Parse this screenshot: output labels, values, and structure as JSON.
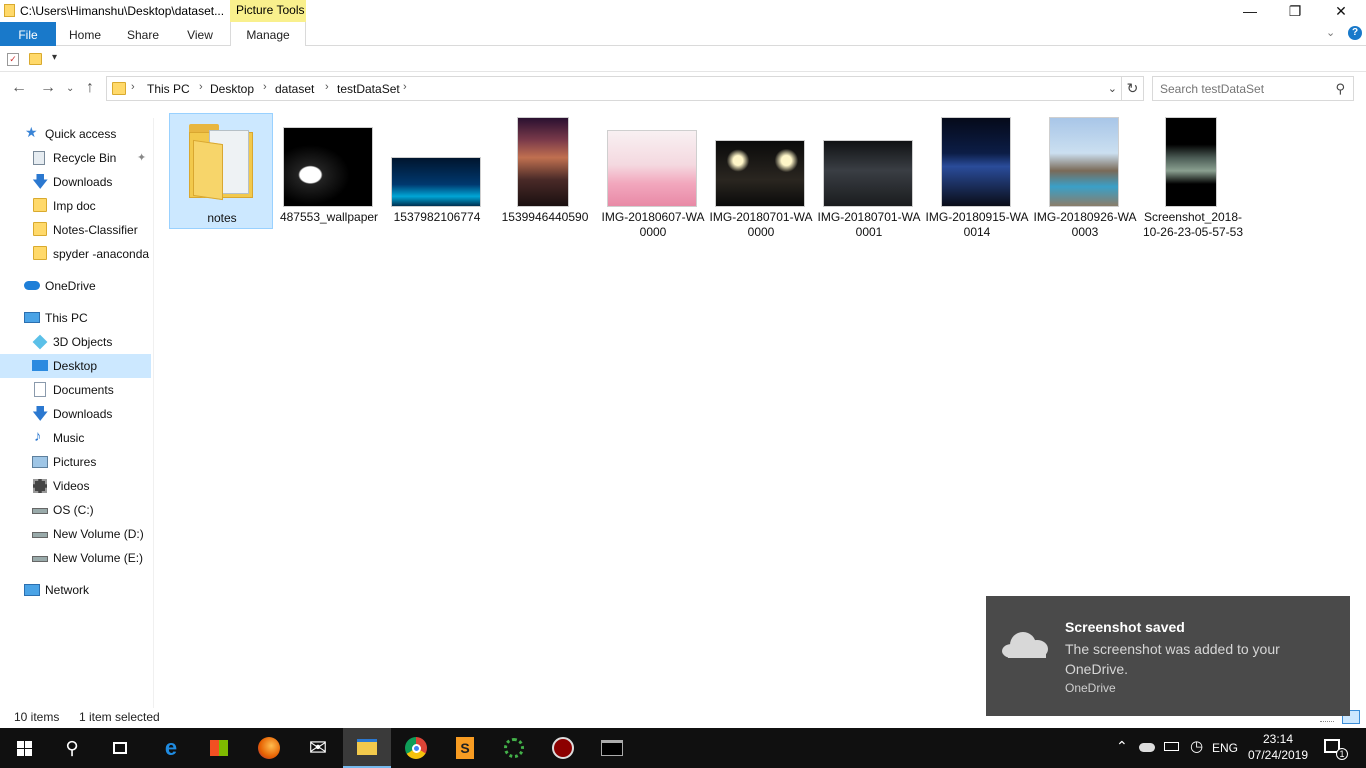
{
  "window": {
    "title": "C:\\Users\\Himanshu\\Desktop\\dataset...",
    "context_tab_group": "Picture Tools"
  },
  "ribbon": {
    "tabs": [
      "File",
      "Home",
      "Share",
      "View",
      "Manage"
    ]
  },
  "address": {
    "crumbs": [
      "This PC",
      "Desktop",
      "dataset",
      "testDataSet"
    ]
  },
  "search": {
    "placeholder": "Search testDataSet"
  },
  "sidebar": {
    "quick_access": "Quick access",
    "quick_items": [
      "Recycle Bin",
      "Downloads",
      "Imp doc",
      "Notes-Classifier",
      "spyder -anaconda"
    ],
    "onedrive": "OneDrive",
    "this_pc": "This PC",
    "pc_items": [
      "3D Objects",
      "Desktop",
      "Documents",
      "Downloads",
      "Music",
      "Pictures",
      "Videos",
      "OS (C:)",
      "New Volume (D:)",
      "New Volume (E:)"
    ],
    "network": "Network"
  },
  "files": [
    {
      "name": "notes"
    },
    {
      "name": "487553_wallpaper"
    },
    {
      "name": "1537982106774"
    },
    {
      "name": "1539946440590"
    },
    {
      "name": "IMG-20180607-WA0000"
    },
    {
      "name": "IMG-20180701-WA0000"
    },
    {
      "name": "IMG-20180701-WA0001"
    },
    {
      "name": "IMG-20180915-WA0014"
    },
    {
      "name": "IMG-20180926-WA0003"
    },
    {
      "name": "Screenshot_2018-10-26-23-05-57-53"
    }
  ],
  "status": {
    "count": "10 items",
    "selected": "1 item selected"
  },
  "toast": {
    "title": "Screenshot saved",
    "body": "The screenshot was added to your OneDrive.",
    "source": "OneDrive"
  },
  "tray": {
    "lang": "ENG",
    "time": "23:14",
    "date": "07/24/2019",
    "notif_count": "1"
  },
  "colors": {
    "accent": "#1979ca",
    "selection": "#cce8ff",
    "context_tab": "#f9f08d",
    "taskbar": "#101010",
    "toast": "#4a4a4a"
  }
}
